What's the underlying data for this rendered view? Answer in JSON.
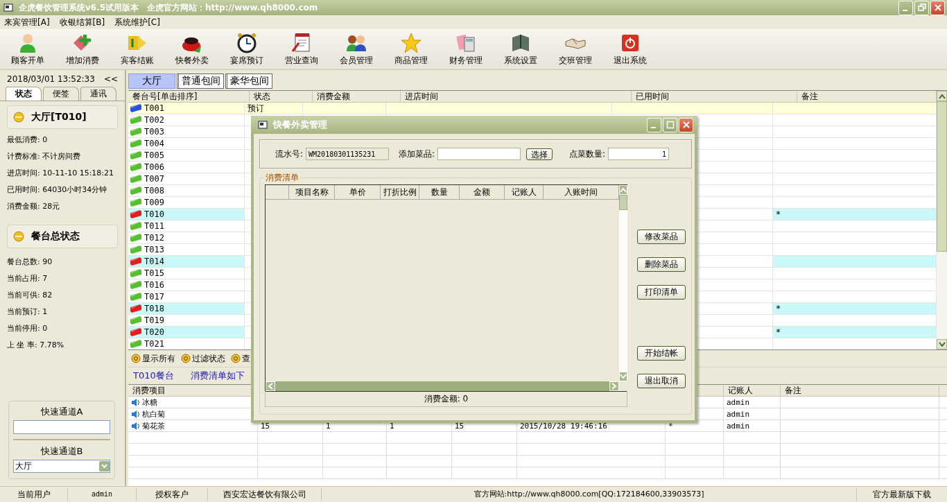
{
  "window": {
    "title": "企虎餐饮管理系统v6.5试用版本　企虎官方网站：http://www.qh8000.com"
  },
  "menu": [
    "来宾管理[A]",
    "收银结算[B]",
    "系统维护[C]"
  ],
  "toolbar": [
    "顾客开单",
    "增加消费",
    "宾客结账",
    "快餐外卖",
    "宴席预订",
    "营业查询",
    "会员管理",
    "商品管理",
    "财务管理",
    "系统设置",
    "交班管理",
    "退出系统"
  ],
  "sidebar": {
    "datetime": "2018/03/01 13:52:33",
    "collapse": "<<",
    "tabs": [
      {
        "label": "状态",
        "selected": true
      },
      {
        "label": "便签",
        "selected": false
      },
      {
        "label": "通讯",
        "selected": false
      }
    ],
    "table_title": "大厅[T010]",
    "table_info": [
      "最低消费: 0",
      "计费标准: 不计房间费",
      "进店时间: 10-11-10 15:18:21",
      "已用时间: 64030小时34分钟",
      "消费金额: 28元"
    ],
    "summary_title": "餐台总状态",
    "summary": [
      "餐台总数: 90",
      "当前占用: 7",
      "当前可供: 82",
      "当前预订: 1",
      "当前停用: 0",
      "上 坐 率: 7.78%"
    ],
    "quick_a": {
      "label": "快速通道A"
    },
    "quick_b": {
      "label": "快速通道B",
      "value": "大厅"
    }
  },
  "room_tabs": [
    {
      "label": "大厅",
      "selected": true
    },
    {
      "label": "普通包间",
      "selected": false
    },
    {
      "label": "豪华包间",
      "selected": false
    }
  ],
  "tables": {
    "columns": [
      "餐台号[单击排序]",
      "状态",
      "消费金额",
      "进店时间",
      "已用时间",
      "备注"
    ],
    "rows": [
      {
        "id": "T001",
        "color": "#2a52d8",
        "occupied": false,
        "selected": true,
        "status": "预订"
      },
      {
        "id": "T002",
        "color": "#58c030",
        "occupied": false,
        "selected": false
      },
      {
        "id": "T003",
        "color": "#58c030",
        "occupied": false,
        "selected": false
      },
      {
        "id": "T004",
        "color": "#58c030",
        "occupied": false,
        "selected": false
      },
      {
        "id": "T005",
        "color": "#58c030",
        "occupied": false,
        "selected": false
      },
      {
        "id": "T006",
        "color": "#58c030",
        "occupied": false,
        "selected": false
      },
      {
        "id": "T007",
        "color": "#58c030",
        "occupied": false,
        "selected": false
      },
      {
        "id": "T008",
        "color": "#58c030",
        "occupied": false,
        "selected": false
      },
      {
        "id": "T009",
        "color": "#58c030",
        "occupied": false,
        "selected": false
      },
      {
        "id": "T010",
        "color": "#e02020",
        "occupied": true,
        "selected": false,
        "note": "*"
      },
      {
        "id": "T011",
        "color": "#58c030",
        "occupied": false,
        "selected": false
      },
      {
        "id": "T012",
        "color": "#58c030",
        "occupied": false,
        "selected": false
      },
      {
        "id": "T013",
        "color": "#58c030",
        "occupied": false,
        "selected": false
      },
      {
        "id": "T014",
        "color": "#e02020",
        "occupied": true,
        "selected": false
      },
      {
        "id": "T015",
        "color": "#58c030",
        "occupied": false,
        "selected": false
      },
      {
        "id": "T016",
        "color": "#58c030",
        "occupied": false,
        "selected": false
      },
      {
        "id": "T017",
        "color": "#58c030",
        "occupied": false,
        "selected": false
      },
      {
        "id": "T018",
        "color": "#e02020",
        "occupied": true,
        "selected": false,
        "note": "*"
      },
      {
        "id": "T019",
        "color": "#58c030",
        "occupied": false,
        "selected": false
      },
      {
        "id": "T020",
        "color": "#e02020",
        "occupied": true,
        "selected": false,
        "note": "*"
      },
      {
        "id": "T021",
        "color": "#58c030",
        "occupied": false,
        "selected": false
      }
    ]
  },
  "filters": [
    "显示所有",
    "过滤状态",
    "查"
  ],
  "order_info": {
    "table": "T010餐台",
    "caption": "消费清单如下"
  },
  "order_items": {
    "columns": {
      "item": "消费项目",
      "recorder": "记账人",
      "note": "备注"
    },
    "rows": [
      {
        "item": "冰糖",
        "recorder": "admin"
      },
      {
        "item": "杭白菊",
        "recorder": "admin"
      },
      {
        "item": "菊花茶",
        "column_2": "15",
        "column_3": "1",
        "column_4": "1",
        "column_5": "15",
        "column_6": "2015/10/28 19:46:16",
        "column_7": "*",
        "recorder": "admin"
      }
    ]
  },
  "status_bar": [
    "当前用户",
    "admin",
    "授权客户",
    "西安宏达餐饮有限公司",
    "官方网站:http://www.qh8000.com[QQ:172184600,33903573]",
    "官方最新版下载"
  ],
  "dialog": {
    "title": "快餐外卖管理",
    "serial_label": "流水号:",
    "serial_value": "WM20180301135231",
    "add_label": "添加菜品:",
    "choose": "选择",
    "qty_label": "点菜数量:",
    "qty_value": "1",
    "group": "消费清单",
    "columns": [
      "项目名称",
      "单价",
      "打折比例",
      "数量",
      "金额",
      "记账人",
      "入账时间"
    ],
    "buttons": [
      "修改菜品",
      "删除菜品",
      "打印清单",
      "开始结帐",
      "退出取消"
    ],
    "total": "消费金额: 0"
  }
}
